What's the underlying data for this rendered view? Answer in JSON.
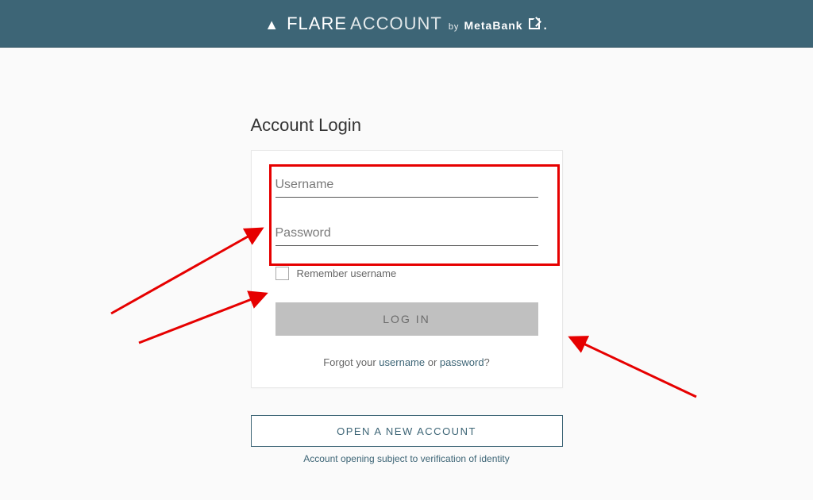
{
  "header": {
    "logo_text_1": "FLARE",
    "logo_text_2": "ACCOUNT",
    "logo_by": "by",
    "logo_meta": "MetaBank"
  },
  "title": "Account Login",
  "form": {
    "username_placeholder": "Username",
    "password_placeholder": "Password",
    "remember_label": "Remember username",
    "login_button": "LOG IN",
    "forgot_prefix": "Forgot your ",
    "forgot_username": "username",
    "forgot_or": " or ",
    "forgot_password": "password",
    "forgot_suffix": "?"
  },
  "cta": {
    "open_account": "OPEN A NEW ACCOUNT",
    "disclaimer": "Account opening subject to verification of identity"
  }
}
